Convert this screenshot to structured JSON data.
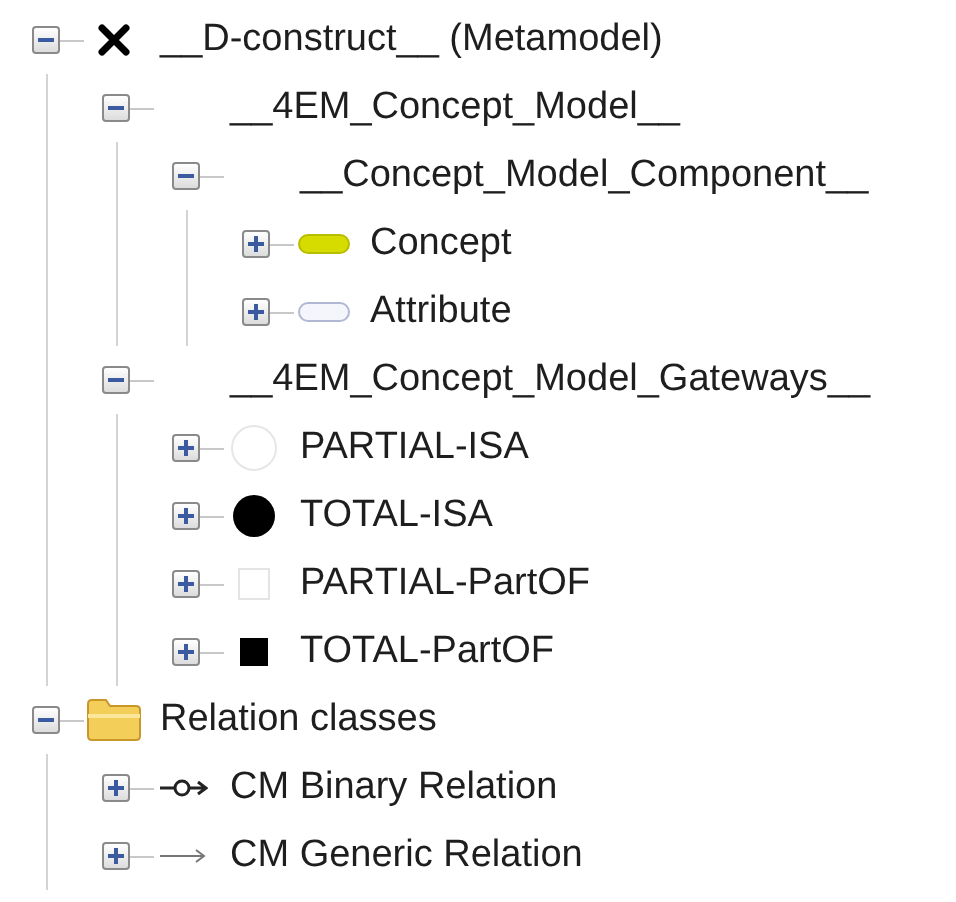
{
  "tree": [
    {
      "label": "__D-construct__ (Metamodel)",
      "kind": "cross",
      "expanded": true,
      "children": [
        {
          "label": "__4EM_Concept_Model__",
          "kind": "plain",
          "expanded": true,
          "children": [
            {
              "label": "__Concept_Model_Component__",
              "kind": "plain",
              "expanded": true,
              "children": [
                {
                  "label": "Concept",
                  "kind": "concept",
                  "expanded": false
                },
                {
                  "label": "Attribute",
                  "kind": "attribute",
                  "expanded": false
                }
              ]
            }
          ]
        },
        {
          "label": "__4EM_Concept_Model_Gateways__",
          "kind": "plain",
          "expanded": true,
          "children": [
            {
              "label": "PARTIAL-ISA",
              "kind": "partial-isa",
              "expanded": false
            },
            {
              "label": "TOTAL-ISA",
              "kind": "total-isa",
              "expanded": false
            },
            {
              "label": "PARTIAL-PartOF",
              "kind": "partial-partof",
              "expanded": false
            },
            {
              "label": "TOTAL-PartOF",
              "kind": "total-partof",
              "expanded": false
            }
          ]
        }
      ]
    },
    {
      "label": "Relation classes",
      "kind": "folder",
      "expanded": true,
      "children": [
        {
          "label": "CM Binary Relation",
          "kind": "binary",
          "expanded": false
        },
        {
          "label": "CM Generic Relation",
          "kind": "generic",
          "expanded": false
        }
      ]
    }
  ]
}
